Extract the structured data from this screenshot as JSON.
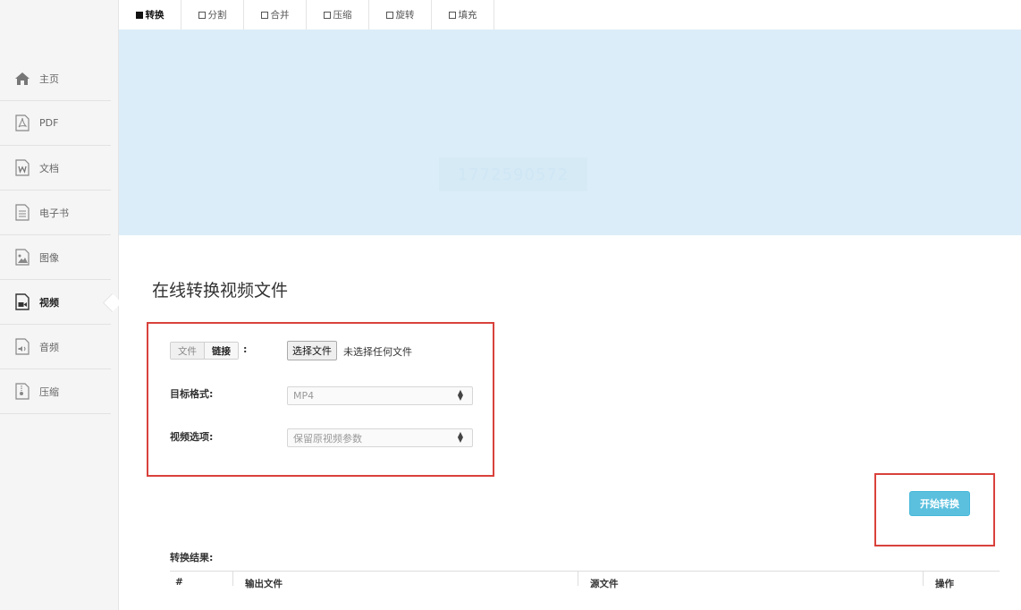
{
  "tabs": [
    {
      "label": "转换",
      "active": true
    },
    {
      "label": "分割",
      "active": false
    },
    {
      "label": "合并",
      "active": false
    },
    {
      "label": "压缩",
      "active": false
    },
    {
      "label": "旋转",
      "active": false
    },
    {
      "label": "填充",
      "active": false
    }
  ],
  "sidebar": {
    "items": [
      {
        "label": "主页",
        "icon": "home-icon"
      },
      {
        "label": "PDF",
        "icon": "pdf-icon"
      },
      {
        "label": "文档",
        "icon": "word-document-icon"
      },
      {
        "label": "电子书",
        "icon": "ebook-icon"
      },
      {
        "label": "图像",
        "icon": "image-icon"
      },
      {
        "label": "视频",
        "icon": "video-icon",
        "active": true
      },
      {
        "label": "音频",
        "icon": "audio-icon"
      },
      {
        "label": "压缩",
        "icon": "archive-icon"
      }
    ]
  },
  "banner": {
    "text": "1772590572"
  },
  "page": {
    "title": "在线转换视频文件"
  },
  "form": {
    "source_tab_file": "文件",
    "source_tab_link": "链接",
    "source_colon": ":",
    "file_button": "选择文件",
    "file_status": "未选择任何文件",
    "target_format_label": "目标格式:",
    "target_format_value": "MP4",
    "video_options_label": "视频选项:",
    "video_options_value": "保留原视频参数"
  },
  "actions": {
    "start_label": "开始转换"
  },
  "results": {
    "title": "转换结果:",
    "columns": [
      "#",
      "输出文件",
      "源文件",
      "操作"
    ]
  },
  "colors": {
    "banner_bg": "#dbedf8",
    "highlight_border": "#d9413c",
    "start_button": "#5bc0de",
    "sidebar_bg": "#f5f5f5"
  }
}
